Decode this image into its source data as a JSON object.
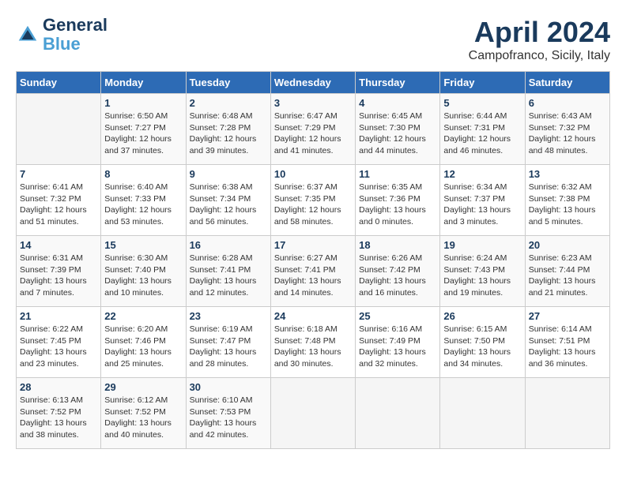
{
  "header": {
    "logo_line1": "General",
    "logo_line2": "Blue",
    "title": "April 2024",
    "subtitle": "Campofranco, Sicily, Italy"
  },
  "calendar": {
    "days_of_week": [
      "Sunday",
      "Monday",
      "Tuesday",
      "Wednesday",
      "Thursday",
      "Friday",
      "Saturday"
    ],
    "weeks": [
      [
        {
          "day": "",
          "info": ""
        },
        {
          "day": "1",
          "info": "Sunrise: 6:50 AM\nSunset: 7:27 PM\nDaylight: 12 hours\nand 37 minutes."
        },
        {
          "day": "2",
          "info": "Sunrise: 6:48 AM\nSunset: 7:28 PM\nDaylight: 12 hours\nand 39 minutes."
        },
        {
          "day": "3",
          "info": "Sunrise: 6:47 AM\nSunset: 7:29 PM\nDaylight: 12 hours\nand 41 minutes."
        },
        {
          "day": "4",
          "info": "Sunrise: 6:45 AM\nSunset: 7:30 PM\nDaylight: 12 hours\nand 44 minutes."
        },
        {
          "day": "5",
          "info": "Sunrise: 6:44 AM\nSunset: 7:31 PM\nDaylight: 12 hours\nand 46 minutes."
        },
        {
          "day": "6",
          "info": "Sunrise: 6:43 AM\nSunset: 7:32 PM\nDaylight: 12 hours\nand 48 minutes."
        }
      ],
      [
        {
          "day": "7",
          "info": "Sunrise: 6:41 AM\nSunset: 7:32 PM\nDaylight: 12 hours\nand 51 minutes."
        },
        {
          "day": "8",
          "info": "Sunrise: 6:40 AM\nSunset: 7:33 PM\nDaylight: 12 hours\nand 53 minutes."
        },
        {
          "day": "9",
          "info": "Sunrise: 6:38 AM\nSunset: 7:34 PM\nDaylight: 12 hours\nand 56 minutes."
        },
        {
          "day": "10",
          "info": "Sunrise: 6:37 AM\nSunset: 7:35 PM\nDaylight: 12 hours\nand 58 minutes."
        },
        {
          "day": "11",
          "info": "Sunrise: 6:35 AM\nSunset: 7:36 PM\nDaylight: 13 hours\nand 0 minutes."
        },
        {
          "day": "12",
          "info": "Sunrise: 6:34 AM\nSunset: 7:37 PM\nDaylight: 13 hours\nand 3 minutes."
        },
        {
          "day": "13",
          "info": "Sunrise: 6:32 AM\nSunset: 7:38 PM\nDaylight: 13 hours\nand 5 minutes."
        }
      ],
      [
        {
          "day": "14",
          "info": "Sunrise: 6:31 AM\nSunset: 7:39 PM\nDaylight: 13 hours\nand 7 minutes."
        },
        {
          "day": "15",
          "info": "Sunrise: 6:30 AM\nSunset: 7:40 PM\nDaylight: 13 hours\nand 10 minutes."
        },
        {
          "day": "16",
          "info": "Sunrise: 6:28 AM\nSunset: 7:41 PM\nDaylight: 13 hours\nand 12 minutes."
        },
        {
          "day": "17",
          "info": "Sunrise: 6:27 AM\nSunset: 7:41 PM\nDaylight: 13 hours\nand 14 minutes."
        },
        {
          "day": "18",
          "info": "Sunrise: 6:26 AM\nSunset: 7:42 PM\nDaylight: 13 hours\nand 16 minutes."
        },
        {
          "day": "19",
          "info": "Sunrise: 6:24 AM\nSunset: 7:43 PM\nDaylight: 13 hours\nand 19 minutes."
        },
        {
          "day": "20",
          "info": "Sunrise: 6:23 AM\nSunset: 7:44 PM\nDaylight: 13 hours\nand 21 minutes."
        }
      ],
      [
        {
          "day": "21",
          "info": "Sunrise: 6:22 AM\nSunset: 7:45 PM\nDaylight: 13 hours\nand 23 minutes."
        },
        {
          "day": "22",
          "info": "Sunrise: 6:20 AM\nSunset: 7:46 PM\nDaylight: 13 hours\nand 25 minutes."
        },
        {
          "day": "23",
          "info": "Sunrise: 6:19 AM\nSunset: 7:47 PM\nDaylight: 13 hours\nand 28 minutes."
        },
        {
          "day": "24",
          "info": "Sunrise: 6:18 AM\nSunset: 7:48 PM\nDaylight: 13 hours\nand 30 minutes."
        },
        {
          "day": "25",
          "info": "Sunrise: 6:16 AM\nSunset: 7:49 PM\nDaylight: 13 hours\nand 32 minutes."
        },
        {
          "day": "26",
          "info": "Sunrise: 6:15 AM\nSunset: 7:50 PM\nDaylight: 13 hours\nand 34 minutes."
        },
        {
          "day": "27",
          "info": "Sunrise: 6:14 AM\nSunset: 7:51 PM\nDaylight: 13 hours\nand 36 minutes."
        }
      ],
      [
        {
          "day": "28",
          "info": "Sunrise: 6:13 AM\nSunset: 7:52 PM\nDaylight: 13 hours\nand 38 minutes."
        },
        {
          "day": "29",
          "info": "Sunrise: 6:12 AM\nSunset: 7:52 PM\nDaylight: 13 hours\nand 40 minutes."
        },
        {
          "day": "30",
          "info": "Sunrise: 6:10 AM\nSunset: 7:53 PM\nDaylight: 13 hours\nand 42 minutes."
        },
        {
          "day": "",
          "info": ""
        },
        {
          "day": "",
          "info": ""
        },
        {
          "day": "",
          "info": ""
        },
        {
          "day": "",
          "info": ""
        }
      ]
    ]
  }
}
